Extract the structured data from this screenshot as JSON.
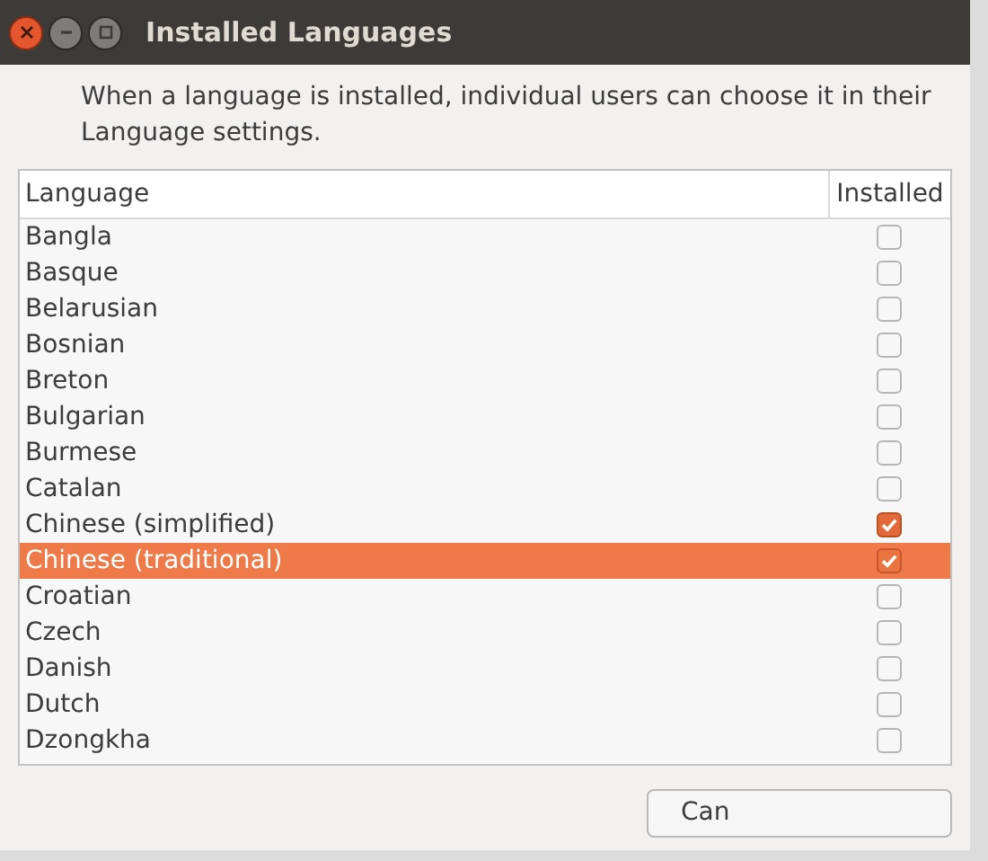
{
  "window": {
    "title": "Installed Languages"
  },
  "description": "When a language is installed, individual users can choose it in their Language settings.",
  "table": {
    "columns": [
      "Language",
      "Installed"
    ],
    "rows": [
      {
        "name": "Bangla",
        "installed": false,
        "selected": false
      },
      {
        "name": "Basque",
        "installed": false,
        "selected": false
      },
      {
        "name": "Belarusian",
        "installed": false,
        "selected": false
      },
      {
        "name": "Bosnian",
        "installed": false,
        "selected": false
      },
      {
        "name": "Breton",
        "installed": false,
        "selected": false
      },
      {
        "name": "Bulgarian",
        "installed": false,
        "selected": false
      },
      {
        "name": "Burmese",
        "installed": false,
        "selected": false
      },
      {
        "name": "Catalan",
        "installed": false,
        "selected": false
      },
      {
        "name": "Chinese (simplified)",
        "installed": true,
        "selected": false
      },
      {
        "name": "Chinese (traditional)",
        "installed": true,
        "selected": true
      },
      {
        "name": "Croatian",
        "installed": false,
        "selected": false
      },
      {
        "name": "Czech",
        "installed": false,
        "selected": false
      },
      {
        "name": "Danish",
        "installed": false,
        "selected": false
      },
      {
        "name": "Dutch",
        "installed": false,
        "selected": false
      },
      {
        "name": "Dzongkha",
        "installed": false,
        "selected": false
      }
    ]
  },
  "buttons": [
    "Can"
  ]
}
